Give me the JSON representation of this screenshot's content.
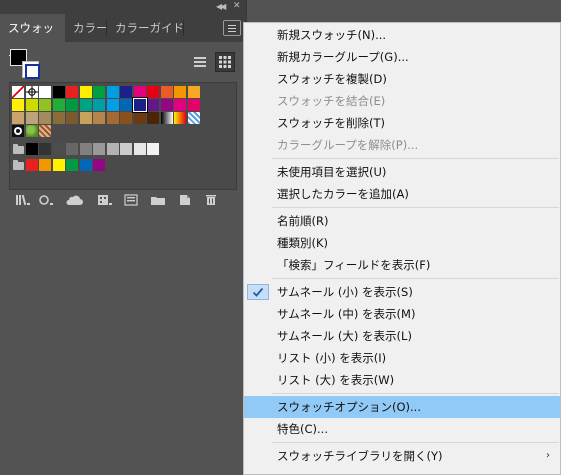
{
  "panel": {
    "tabs": [
      {
        "label": "スウォッチ",
        "active": true
      },
      {
        "label": "カラー",
        "active": false
      },
      {
        "label": "カラーガイド",
        "active": false
      }
    ],
    "topbar_icons": [
      "collapse-icon",
      "close-icon"
    ],
    "view_buttons": [
      "list-view-icon",
      "grid-view-icon"
    ],
    "swatch_rows": [
      [
        "none",
        "registration",
        "#ffffff",
        "#000000",
        "#e6211f",
        "#ffed00",
        "#00a03c",
        "#00a0e0",
        "#1d2088",
        "#e4007f",
        "#e60012",
        "#eb5a27",
        "#f39700",
        "#f7a823"
      ],
      [
        "#fff100",
        "#cfdb00",
        "#8fc31f",
        "#22ac38",
        "#009944",
        "#00a381",
        "#009fa8",
        "#00a0e9",
        "#0068b7",
        "#1d2088",
        "#601986",
        "#920783",
        "#e4007f",
        "#e5006a"
      ],
      [
        "#c9a46d",
        "#bda37c",
        "#a48b5c",
        "#8b6d3b",
        "#7b5a2e",
        "#c7a25b",
        "#b7844d",
        "#a46a2f",
        "#8a4f1b",
        "#6b3a12",
        "#4a2508",
        "gradient-bw",
        "gradient-orange",
        "gradient-blue"
      ],
      [
        "pattern-circle",
        "pattern-leaf",
        "pattern-brown"
      ],
      [
        "folder",
        "#000000",
        "#333333",
        "#4d4d4d",
        "#666666",
        "#808080",
        "#999999",
        "#b3b3b3",
        "#cccccc",
        "#e6e6e6",
        "#f2f2f2"
      ],
      [
        "folder",
        "#e6211f",
        "#f39700",
        "#fff100",
        "#009944",
        "#0068b7",
        "#920783"
      ]
    ],
    "bottom_icons": [
      "swatch-library-icon",
      "show-swatch-kinds-icon",
      "cloud-library-icon",
      "swatch-options-icon",
      "new-color-group-icon",
      "new-swatch-icon",
      "delete-swatch-icon"
    ]
  },
  "menu": {
    "items": [
      {
        "label": "新規スウォッチ(N)...",
        "disabled": false
      },
      {
        "label": "新規カラーグループ(G)...",
        "disabled": false
      },
      {
        "label": "スウォッチを複製(D)",
        "disabled": false
      },
      {
        "label": "スウォッチを結合(E)",
        "disabled": true
      },
      {
        "label": "スウォッチを削除(T)",
        "disabled": false
      },
      {
        "label": "カラーグループを解除(P)...",
        "disabled": true
      },
      {
        "separator": true
      },
      {
        "label": "未使用項目を選択(U)",
        "disabled": false
      },
      {
        "label": "選択したカラーを追加(A)",
        "disabled": false
      },
      {
        "separator": true
      },
      {
        "label": "名前順(R)",
        "disabled": false
      },
      {
        "label": "種類別(K)",
        "disabled": false
      },
      {
        "label": "「検索」フィールドを表示(F)",
        "disabled": false
      },
      {
        "separator": true
      },
      {
        "label": "サムネール (小) を表示(S)",
        "disabled": false,
        "checked": true
      },
      {
        "label": "サムネール (中) を表示(M)",
        "disabled": false
      },
      {
        "label": "サムネール (大) を表示(L)",
        "disabled": false
      },
      {
        "label": "リスト (小) を表示(I)",
        "disabled": false
      },
      {
        "label": "リスト (大) を表示(W)",
        "disabled": false
      },
      {
        "separator": true
      },
      {
        "label": "スウォッチオプション(O)...",
        "disabled": false,
        "highlighted": true
      },
      {
        "label": "特色(C)...",
        "disabled": false
      },
      {
        "separator": true
      },
      {
        "label": "スウォッチライブラリを開く(Y)",
        "disabled": false,
        "submenu": true
      }
    ]
  },
  "colors": {
    "app_background": "#535353",
    "menu_background": "#f0f0f0",
    "menu_highlight": "#91c9f7",
    "disabled_text": "#8d8d8d"
  }
}
